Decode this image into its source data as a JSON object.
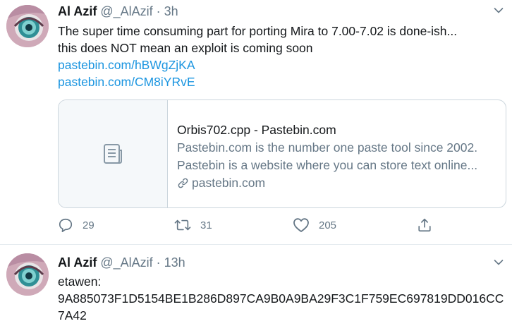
{
  "colors": {
    "accent": "#1b95e0",
    "secondary_text": "#657786",
    "primary_text": "#14171a",
    "border": "#ccd6dd"
  },
  "tweets": [
    {
      "name": "Al Azif",
      "handle": "@_AlAzif",
      "separator": "·",
      "time": "3h",
      "lines": [
        "The super time consuming part for porting Mira to 7.00-7.02 is done-ish...",
        "this does NOT mean an exploit is coming soon"
      ],
      "links": [
        "pastebin.com/hBWgZjKA",
        "pastebin.com/CM8iYRvE"
      ],
      "card": {
        "icon": "document-icon",
        "title": "Orbis702.cpp - Pastebin.com",
        "desc_line1": "Pastebin.com is the number one paste tool since 2002.",
        "desc_line2": "Pastebin is a website where you can store text online...",
        "domain": "pastebin.com"
      },
      "actions": {
        "replies": "29",
        "retweets": "31",
        "likes": "205"
      }
    },
    {
      "name": "Al Azif",
      "handle": "@_AlAzif",
      "separator": "·",
      "time": "13h",
      "lines": [
        "etawen:",
        "9A885073F1D5154BE1B286D897CA9B0A9BA29F3C1F759EC697819DD016CC",
        "7A42"
      ]
    }
  ]
}
